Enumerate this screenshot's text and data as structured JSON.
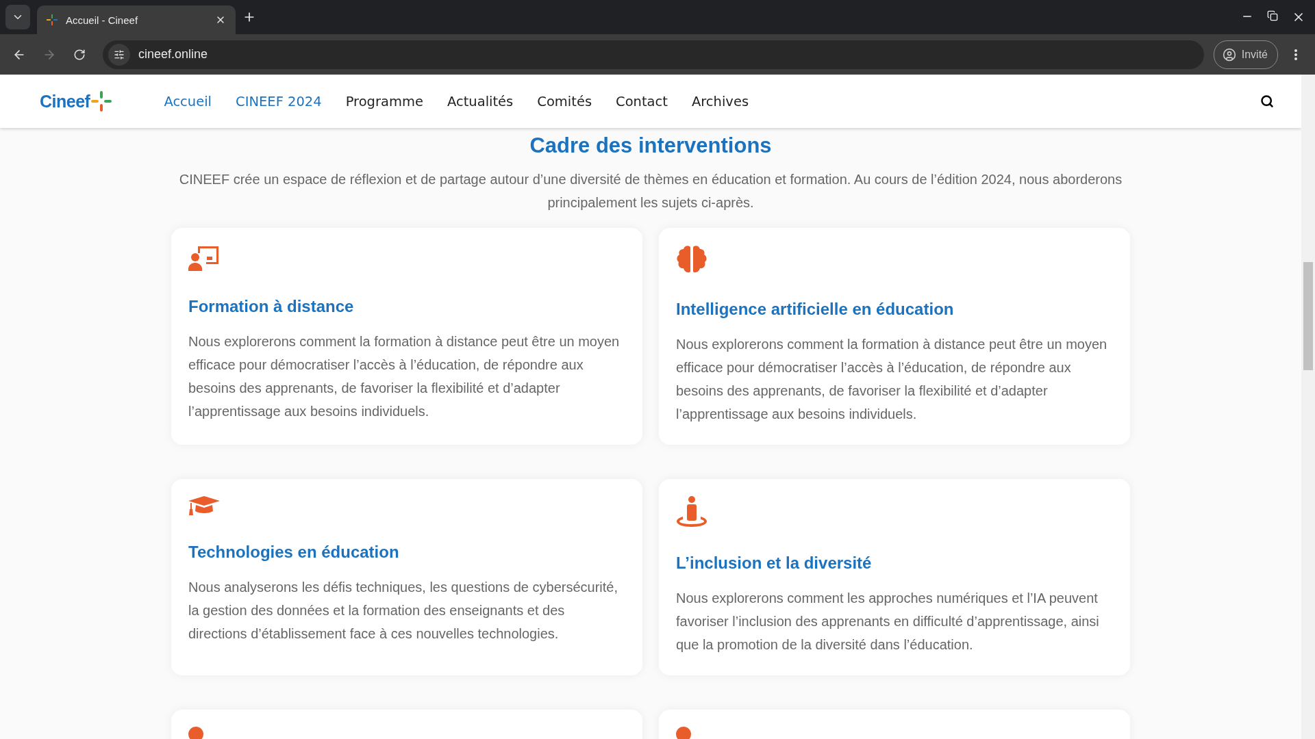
{
  "browser": {
    "tab_title": "Accueil - Cineef",
    "url": "cineef.online",
    "profile": "Invité"
  },
  "site": {
    "logo": "Cineef",
    "nav": [
      {
        "label": "Accueil",
        "active": true
      },
      {
        "label": "CINEEF 2024",
        "active": true
      },
      {
        "label": "Programme",
        "active": false
      },
      {
        "label": "Actualités",
        "active": false
      },
      {
        "label": "Comités",
        "active": false
      },
      {
        "label": "Contact",
        "active": false
      },
      {
        "label": "Archives",
        "active": false
      }
    ]
  },
  "section": {
    "title": "Cadre des interventions",
    "intro": "CINEEF crée un espace de réflexion et de partage autour d’une diversité de thèmes en éducation et formation. Au cours de l’édition 2024, nous aborderons principalement les sujets ci-après.",
    "cards": [
      {
        "kind": "presentation",
        "title": "Formation à distance",
        "text": "Nous explorerons comment la formation à distance peut être un moyen efficace pour démocratiser l’accès à l’éducation, de répondre aux besoins des apprenants, de favoriser la flexibilité et d’adapter l’apprentissage aux besoins individuels."
      },
      {
        "kind": "brain",
        "title": "Intelligence artificielle en éducation",
        "text": "Nous explorerons comment la formation à distance peut être un moyen efficace pour démocratiser l’accès à l’éducation, de répondre aux besoins des apprenants, de favoriser la flexibilité et d’adapter l’apprentissage aux besoins individuels."
      },
      {
        "kind": "cap",
        "title": "Technologies en éducation",
        "text": "Nous analyserons les défis techniques, les questions de cybersécurité, la gestion des données et la formation des enseignants et des directions d’établissement face à ces nouvelles technologies."
      },
      {
        "kind": "person",
        "title": "L’inclusion et la diversité",
        "text": "Nous explorerons comment les approches numériques et l’IA peuvent favoriser l’inclusion des apprenants en difficulté d’apprentissage, ainsi que la promotion de la diversité dans l’éducation."
      },
      {
        "kind": "partial"
      },
      {
        "kind": "partial"
      }
    ]
  }
}
